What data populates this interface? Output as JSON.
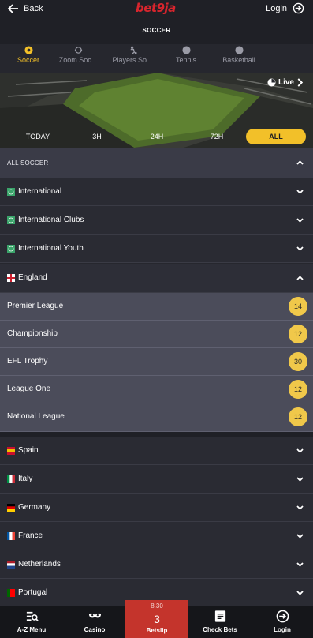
{
  "header": {
    "back_label": "Back",
    "brand": "bet9ja",
    "login_label": "Login",
    "page_title": "SOCCER"
  },
  "sport_tabs": [
    {
      "label": "Soccer",
      "icon": "soccer-ball-icon",
      "active": true
    },
    {
      "label": "Zoom Soc...",
      "icon": "zoom-soccer-icon",
      "active": false
    },
    {
      "label": "Players So...",
      "icon": "players-soccer-icon",
      "active": false
    },
    {
      "label": "Tennis",
      "icon": "tennis-ball-icon",
      "active": false
    },
    {
      "label": "Basketball",
      "icon": "basketball-icon",
      "active": false
    }
  ],
  "banner": {
    "live_label": "Live",
    "filters": [
      "TODAY",
      "3H",
      "24H",
      "72H",
      "ALL"
    ],
    "active_filter": "ALL"
  },
  "all_soccer": {
    "label": "ALL SOCCER"
  },
  "groups_top": [
    {
      "label": "International",
      "flag": "world-flag-icon"
    },
    {
      "label": "International Clubs",
      "flag": "world-flag-icon"
    },
    {
      "label": "International Youth",
      "flag": "world-flag-icon"
    }
  ],
  "england": {
    "label": "England",
    "flag": "england-flag-icon",
    "leagues": [
      {
        "label": "Premier League",
        "count": "14"
      },
      {
        "label": "Championship",
        "count": "12"
      },
      {
        "label": "EFL Trophy",
        "count": "30"
      },
      {
        "label": "League One",
        "count": "12"
      },
      {
        "label": "National League",
        "count": "12"
      }
    ]
  },
  "groups_bottom": [
    {
      "label": "Spain",
      "flag": "spain-flag-icon"
    },
    {
      "label": "Italy",
      "flag": "italy-flag-icon"
    },
    {
      "label": "Germany",
      "flag": "germany-flag-icon"
    },
    {
      "label": "France",
      "flag": "france-flag-icon"
    },
    {
      "label": "Netherlands",
      "flag": "netherlands-flag-icon"
    },
    {
      "label": "Portugal",
      "flag": "portugal-flag-icon"
    }
  ],
  "bottom_nav": {
    "az_menu": "A-Z Menu",
    "casino": "Casino",
    "betslip_amount": "8.30",
    "betslip_count": "3",
    "betslip_label": "Betslip",
    "check_bets": "Check Bets",
    "login": "Login"
  },
  "colors": {
    "accent": "#f2c029",
    "brand_red": "#d8252d",
    "betslip_red": "#c4342c",
    "background": "#26272e"
  }
}
